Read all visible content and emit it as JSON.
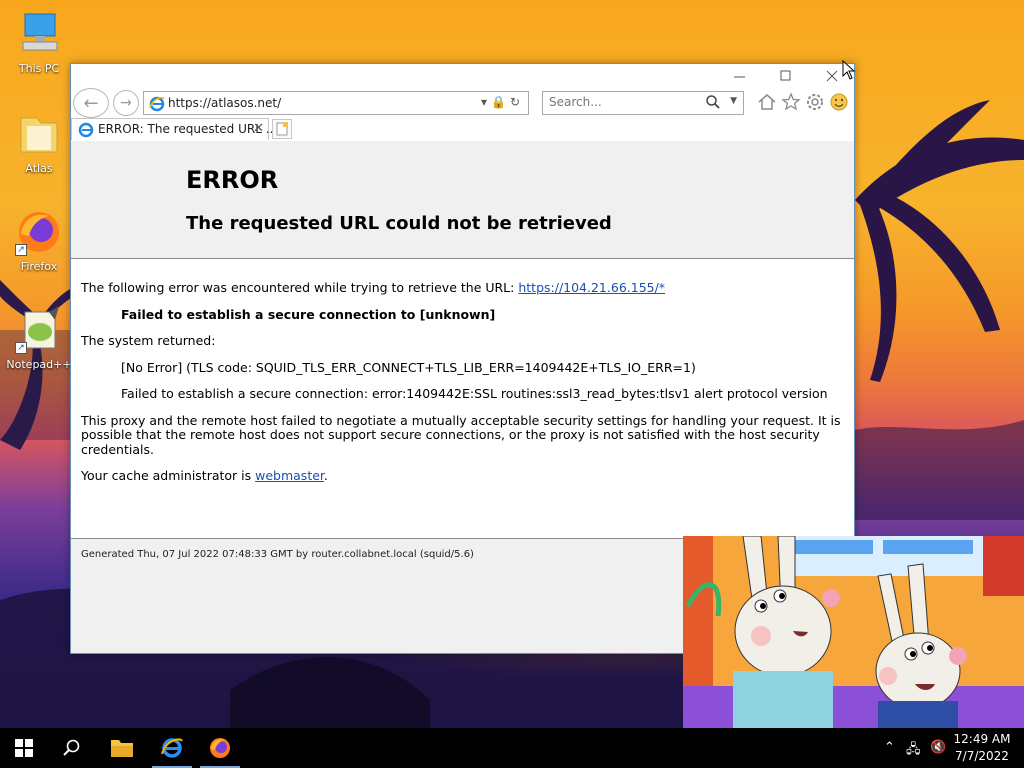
{
  "desktop": {
    "icons": [
      {
        "label": "This PC"
      },
      {
        "label": "Atlas"
      },
      {
        "label": "Firefox"
      },
      {
        "label": "Notepad++"
      }
    ]
  },
  "browser": {
    "address": {
      "url": "https://atlasos.net/"
    },
    "search": {
      "placeholder": "Search..."
    },
    "tab": {
      "title": "ERROR: The requested URL ..."
    }
  },
  "page": {
    "title": "ERROR",
    "subtitle": "The requested URL could not be retrieved",
    "intro": "The following error was encountered while trying to retrieve the URL: ",
    "intro_link": "https://104.21.66.155/*",
    "failed_msg": "Failed to establish a secure connection to [unknown]",
    "system_returned": "The system returned:",
    "error_code": "[No Error] (TLS code: SQUID_TLS_ERR_CONNECT+TLS_LIB_ERR=1409442E+TLS_IO_ERR=1)",
    "error_detail": "Failed to establish a secure connection: error:1409442E:SSL routines:ssl3_read_bytes:tlsv1 alert protocol version",
    "explanation": "This proxy and the remote host failed to negotiate a mutually acceptable security settings for handling your request. It is possible that the remote host does not support secure connections, or the proxy is not satisfied with the host security credentials.",
    "admin_prefix": "Your cache administrator is ",
    "admin_link": "webmaster",
    "admin_suffix": ".",
    "footer": "Generated Thu, 07 Jul 2022 07:48:33 GMT by router.collabnet.local (squid/5.6)"
  },
  "taskbar": {
    "time": "12:49 AM",
    "date": "7/7/2022"
  }
}
